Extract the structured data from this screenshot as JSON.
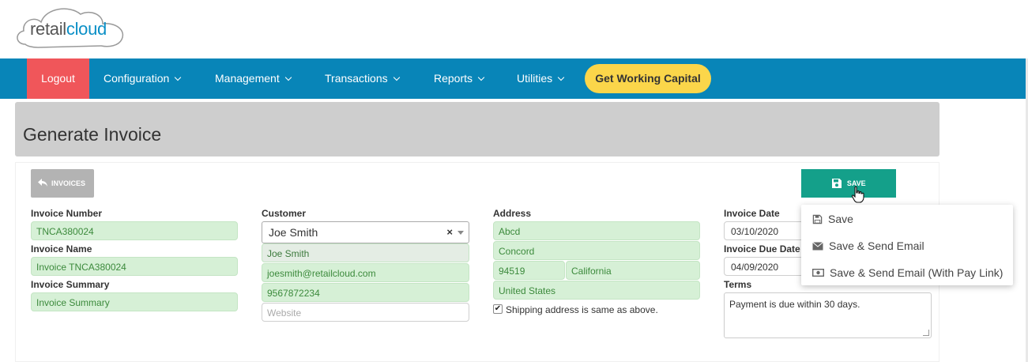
{
  "brand": {
    "logo_part1": "retail",
    "logo_part2": "cloud"
  },
  "nav": {
    "logout": "Logout",
    "items": [
      "Configuration",
      "Management",
      "Transactions",
      "Reports",
      "Utilities"
    ],
    "working_capital": "Get Working Capital"
  },
  "page": {
    "title": "Generate Invoice"
  },
  "actions": {
    "back_label": "INVOICES",
    "save_label": "SAVE"
  },
  "save_menu": {
    "items": [
      {
        "label": "Save",
        "icon": "save-icon"
      },
      {
        "label": "Save & Send Email",
        "icon": "envelope-icon"
      },
      {
        "label": "Save & Send Email (With Pay Link)",
        "icon": "money-icon"
      }
    ]
  },
  "form": {
    "invoice_number": {
      "label": "Invoice Number",
      "value": "TNCA380024"
    },
    "invoice_name": {
      "label": "Invoice Name",
      "value": "Invoice TNCA380024"
    },
    "invoice_summary": {
      "label": "Invoice Summary",
      "value": "Invoice Summary"
    },
    "customer": {
      "label": "Customer",
      "selected": "Joe Smith",
      "clear": "×",
      "name": "Joe Smith",
      "email": "joesmith@retailcloud.com",
      "phone": "9567872234",
      "website_placeholder": "Website"
    },
    "address": {
      "label": "Address",
      "line1": "Abcd",
      "city": "Concord",
      "zip": "94519",
      "state": "California",
      "country": "United States",
      "same_shipping_label": "Shipping address is same as above.",
      "same_shipping_checked": true
    },
    "invoice_date": {
      "label": "Invoice Date",
      "value": "03/10/2020"
    },
    "invoice_due_date": {
      "label": "Invoice Due Date",
      "value": "04/09/2020"
    },
    "terms": {
      "label": "Terms",
      "value": "Payment is due within 30 days."
    }
  },
  "colors": {
    "nav_bg": "#0885b8",
    "logout_bg": "#f0565a",
    "working_capital_bg": "#fbd64a",
    "save_bg": "#14a08a",
    "field_green": "#d6f0d6"
  }
}
